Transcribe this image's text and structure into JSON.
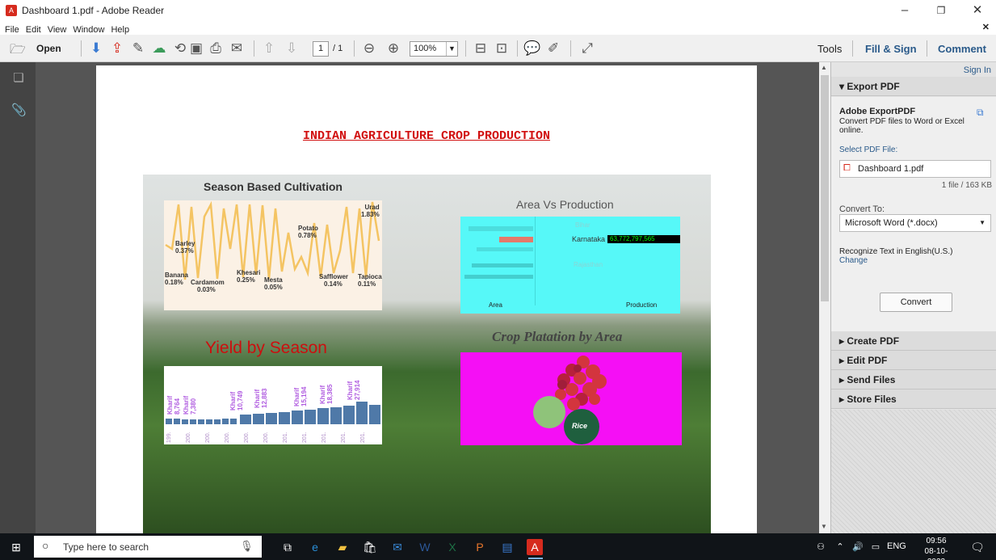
{
  "window": {
    "title": "Dashboard 1.pdf - Adobe Reader"
  },
  "menu": [
    "File",
    "Edit",
    "View",
    "Window",
    "Help"
  ],
  "toolbar": {
    "open_label": "Open",
    "page_current": "1",
    "page_total": "/ 1",
    "zoom": "100%",
    "tools": "Tools",
    "fill_sign": "Fill & Sign",
    "comment": "Comment"
  },
  "document": {
    "title": "INDIAN AGRICULTURE CROP PRODUCTION",
    "season_chart": {
      "title": "Season Based Cultivation",
      "labels": [
        {
          "name": "Barley",
          "value": "0.37%"
        },
        {
          "name": "Banana",
          "value": "0.18%"
        },
        {
          "name": "Cardamom",
          "value": "0.03%"
        },
        {
          "name": "Khesari",
          "value": "0.25%"
        },
        {
          "name": "Mesta",
          "value": "0.05%"
        },
        {
          "name": "Potato",
          "value": "0.78%"
        },
        {
          "name": "Safflower",
          "value": "0.14%"
        },
        {
          "name": "Tapioca",
          "value": "0.11%"
        },
        {
          "name": "Urad",
          "value": "1.83%"
        }
      ]
    },
    "area_chart": {
      "title": "Area Vs Production",
      "states": [
        "Bihar",
        "Karnataka",
        "Rajasthan"
      ],
      "highlight_value": "63,772,797,565",
      "x_labels": [
        "Area",
        "Production"
      ]
    },
    "yield_chart": {
      "title": "Yield by Season",
      "bar_labels": [
        {
          "season": "Kharif",
          "value": "8,764"
        },
        {
          "season": "Kharif",
          "value": "7,380"
        },
        {
          "season": "Kharif",
          "value": "10,749"
        },
        {
          "season": "Kharif",
          "value": "12,883"
        },
        {
          "season": "Kharif",
          "value": "15,194"
        },
        {
          "season": "Kharif",
          "value": "18,385"
        },
        {
          "season": "Kharif",
          "value": "27,914"
        }
      ],
      "x_ticks": [
        "199.",
        "200.",
        "200.",
        "200.",
        "200.",
        "200.",
        "201.",
        "201.",
        "201.",
        "201.",
        "201."
      ]
    },
    "crop_chart": {
      "title": "Crop Platation by Area",
      "label": "Rice"
    }
  },
  "right_panel": {
    "sign_in": "Sign In",
    "export_header": "Export PDF",
    "product": "Adobe ExportPDF",
    "desc": "Convert PDF files to Word or Excel online.",
    "select_label": "Select PDF File:",
    "file_name": "Dashboard 1.pdf",
    "file_info": "1 file / 163 KB",
    "convert_to_label": "Convert To:",
    "convert_to_value": "Microsoft Word (*.docx)",
    "recognize": "Recognize Text in English(U.S.)",
    "change": "Change",
    "convert_button": "Convert",
    "sections": [
      "Create PDF",
      "Edit PDF",
      "Send Files",
      "Store Files"
    ]
  },
  "taskbar": {
    "search_placeholder": "Type here to search",
    "time": "09:56",
    "date": "08-10-2023",
    "lang": "ENG"
  }
}
